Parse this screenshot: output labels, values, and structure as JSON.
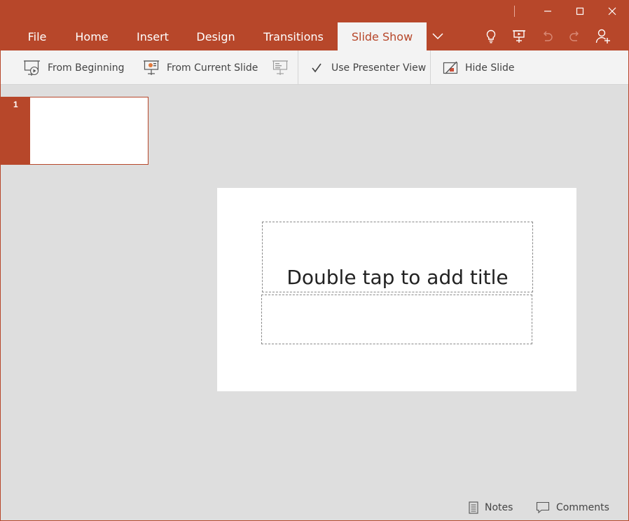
{
  "tabs": [
    {
      "label": "File"
    },
    {
      "label": "Home"
    },
    {
      "label": "Insert"
    },
    {
      "label": "Design"
    },
    {
      "label": "Transitions"
    },
    {
      "label": "Slide Show",
      "active": true
    }
  ],
  "ribbon": {
    "from_beginning": "From Beginning",
    "from_current": "From Current Slide",
    "presenter_view": "Use Presenter View",
    "presenter_view_checked": true,
    "hide_slide": "Hide Slide"
  },
  "thumbnails": [
    {
      "number": "1"
    }
  ],
  "slide": {
    "title_placeholder": "Double tap to add title"
  },
  "status": {
    "notes": "Notes",
    "comments": "Comments"
  },
  "colors": {
    "accent": "#b7472a",
    "ribbon_bg": "#f3f3f3",
    "canvas_bg": "#dedede"
  }
}
